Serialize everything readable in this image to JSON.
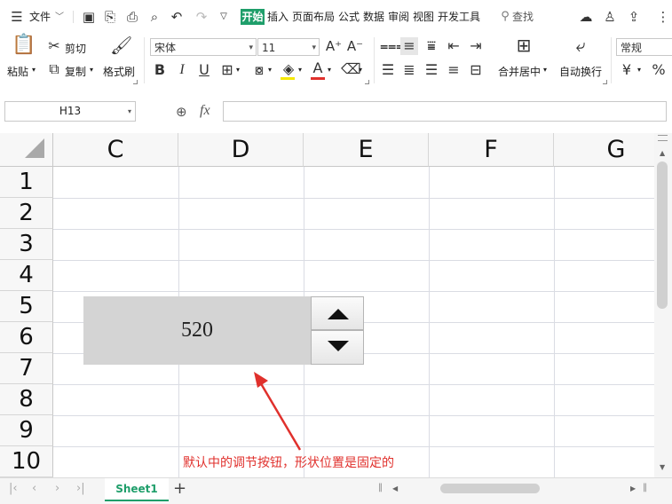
{
  "menu": {
    "file_label": "文件",
    "tabs": [
      "开始",
      "插入",
      "页面布局",
      "公式",
      "数据",
      "审阅",
      "视图",
      "开发工具"
    ],
    "search_label": "查找"
  },
  "ribbon": {
    "paste": "粘贴",
    "cut": "剪切",
    "copy": "复制",
    "format_painter": "格式刷",
    "font_name": "宋体",
    "font_size": "11",
    "merge_center": "合并居中",
    "wrap_text": "自动换行",
    "number_format": "常规",
    "currency_symbol": "¥",
    "percent_symbol": "%",
    "bold": "B",
    "italic": "I",
    "underline": "U"
  },
  "formula_bar": {
    "cell_ref": "H13",
    "fx_label": "fx",
    "value": ""
  },
  "columns": [
    "C",
    "D",
    "E",
    "F",
    "G"
  ],
  "rows": [
    "1",
    "2",
    "3",
    "4",
    "5",
    "6",
    "7",
    "8",
    "9",
    "10"
  ],
  "spin": {
    "value": "520",
    "up_icon": "up-triangle-icon",
    "down_icon": "down-triangle-icon"
  },
  "annotation": "默认中的调节按钮，形状位置是固定的",
  "sheet_tabs": [
    "Sheet1"
  ],
  "colors": {
    "accent": "#1e9e6a",
    "annotation": "#e0302c",
    "spin_bg": "#d4d4d4"
  }
}
